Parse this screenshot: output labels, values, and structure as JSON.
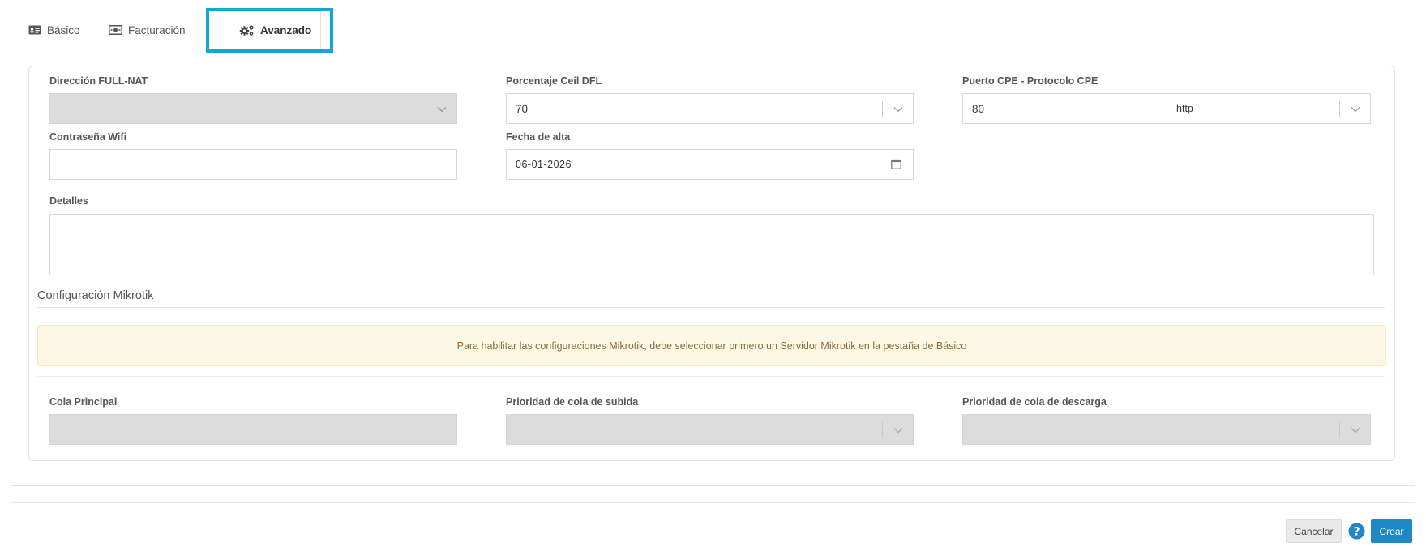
{
  "tabs": [
    {
      "label": "Básico",
      "icon": "id-card-icon"
    },
    {
      "label": "Facturación",
      "icon": "money-bill-icon"
    },
    {
      "label": "Avanzado",
      "icon": "cogs-icon",
      "active": true
    }
  ],
  "form": {
    "direccion_full_nat": {
      "label": "Dirección FULL-NAT",
      "value": ""
    },
    "porcentaje_ceil": {
      "label": "Porcentaje Ceil DFL",
      "value": "70"
    },
    "puerto_cpe": {
      "label": "Puerto CPE - Protocolo CPE",
      "port": "80",
      "protocol": "http"
    },
    "contrasena_wifi": {
      "label": "Contraseña Wifi",
      "value": ""
    },
    "fecha_alta": {
      "label": "Fecha de alta",
      "value": "06-01-2026"
    },
    "detalles": {
      "label": "Detalles",
      "value": ""
    }
  },
  "mikrotik": {
    "title": "Configuración Mikrotik",
    "alert": "Para habilitar las configuraciones Mikrotik, debe seleccionar primero un Servidor Mikrotik en la pestaña de Básico",
    "cola_principal": {
      "label": "Cola Principal",
      "value": ""
    },
    "prioridad_subida": {
      "label": "Prioridad de cola de subida",
      "value": ""
    },
    "prioridad_descarga": {
      "label": "Prioridad de cola de descarga",
      "value": ""
    }
  },
  "footer": {
    "cancel_label": "Cancelar",
    "create_label": "Crear",
    "help_icon": "question-circle-icon"
  },
  "colors": {
    "accent": "#1e88c5",
    "highlight": "#11a7d6",
    "alert_bg": "#fdf7e6",
    "alert_text": "#8a6d3b",
    "disabled": "#dcdcdc"
  }
}
